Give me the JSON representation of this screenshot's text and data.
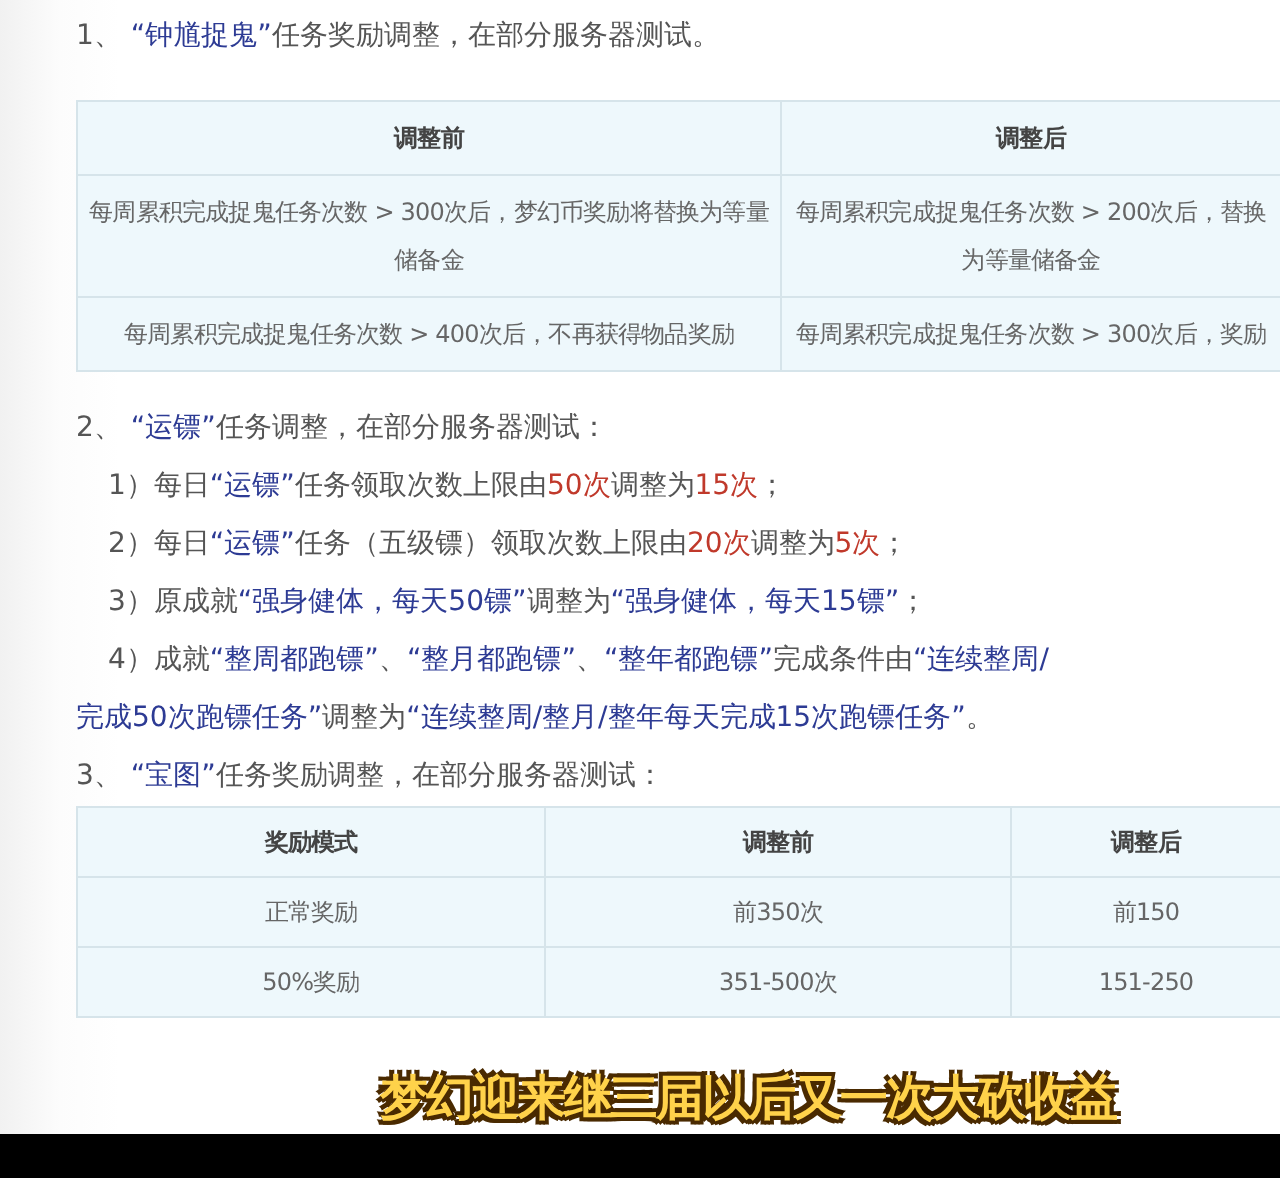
{
  "sections": [
    {
      "kind": "heading",
      "lines": [
        [
          {
            "kind": "plain",
            "text": "1、 "
          },
          {
            "kind": "quote",
            "text": "“钟馗捉鬼”"
          },
          {
            "kind": "plain",
            "text": "任务奖励调整，在部分服务器测试。"
          }
        ]
      ]
    },
    {
      "kind": "table",
      "columns": [
        "调整前",
        "调整后"
      ],
      "rows": [
        [
          "每周累积完成捉鬼任务次数 > 300次后，梦幻币奖励将替换为等量储备金",
          "每周累积完成捉鬼任务次数 > 200次后，替换为等量储备金"
        ],
        [
          "每周累积完成捉鬼任务次数 > 400次后，不再获得物品奖励",
          "每周累积完成捉鬼任务次数 > 300次后，奖励"
        ]
      ]
    },
    {
      "kind": "heading",
      "lines": [
        [
          {
            "kind": "plain",
            "text": "2、 "
          },
          {
            "kind": "quote",
            "text": "“运镖”"
          },
          {
            "kind": "plain",
            "text": "任务调整，在部分服务器测试："
          }
        ]
      ]
    },
    {
      "kind": "item",
      "lines": [
        [
          {
            "kind": "plain",
            "text": "1）每日"
          },
          {
            "kind": "quote",
            "text": "“运镖”"
          },
          {
            "kind": "plain",
            "text": "任务领取次数上限由"
          },
          {
            "kind": "number",
            "text": "50次"
          },
          {
            "kind": "plain",
            "text": "调整为"
          },
          {
            "kind": "number",
            "text": "15次"
          },
          {
            "kind": "plain",
            "text": "；"
          }
        ]
      ]
    },
    {
      "kind": "item",
      "lines": [
        [
          {
            "kind": "plain",
            "text": "2）每日"
          },
          {
            "kind": "quote",
            "text": "“运镖”"
          },
          {
            "kind": "plain",
            "text": "任务（五级镖）领取次数上限由"
          },
          {
            "kind": "number",
            "text": "20次"
          },
          {
            "kind": "plain",
            "text": "调整为"
          },
          {
            "kind": "number",
            "text": "5次"
          },
          {
            "kind": "plain",
            "text": "；"
          }
        ]
      ]
    },
    {
      "kind": "item",
      "lines": [
        [
          {
            "kind": "plain",
            "text": "3）原成就"
          },
          {
            "kind": "quote",
            "text": "“强身健体，每天50镖”"
          },
          {
            "kind": "plain",
            "text": "调整为"
          },
          {
            "kind": "quote",
            "text": "“强身健体，每天15镖”"
          },
          {
            "kind": "plain",
            "text": "；"
          }
        ]
      ]
    },
    {
      "kind": "item",
      "lines": [
        [
          {
            "kind": "plain",
            "text": "4）成就"
          },
          {
            "kind": "quote",
            "text": "“整周都跑镖”"
          },
          {
            "kind": "plain",
            "text": "、"
          },
          {
            "kind": "quote",
            "text": "“整月都跑镖”"
          },
          {
            "kind": "plain",
            "text": "、"
          },
          {
            "kind": "quote",
            "text": "“整年都跑镖”"
          },
          {
            "kind": "plain",
            "text": "完成条件由"
          },
          {
            "kind": "quote",
            "text": "“连续整周/"
          }
        ],
        [
          {
            "kind": "quote",
            "text": "完成50次跑镖任务”"
          },
          {
            "kind": "plain",
            "text": "调整为"
          },
          {
            "kind": "quote",
            "text": "“连续整周/整月/整年每天完成15次跑镖任务”"
          },
          {
            "kind": "plain",
            "text": "。"
          }
        ]
      ]
    },
    {
      "kind": "heading",
      "lines": [
        [
          {
            "kind": "plain",
            "text": "3、 "
          },
          {
            "kind": "quote",
            "text": "“宝图”"
          },
          {
            "kind": "plain",
            "text": "任务奖励调整，在部分服务器测试："
          }
        ]
      ]
    },
    {
      "kind": "table",
      "columns": [
        "奖励模式",
        "调整前",
        "调整后"
      ],
      "rows": [
        [
          "正常奖励",
          "前350次",
          "前150"
        ],
        [
          "50%奖励",
          "351-500次",
          "151-250"
        ]
      ]
    }
  ],
  "subtitle": "梦幻迎来继三届以后又一次大砍收益"
}
